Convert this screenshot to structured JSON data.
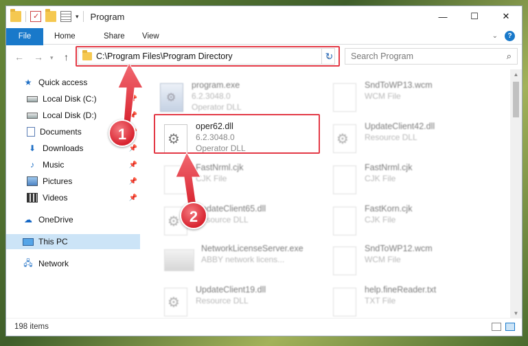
{
  "window": {
    "title": "Program",
    "controls": {
      "minimize": "—",
      "maximize": "☐",
      "close": "✕"
    }
  },
  "ribbon": {
    "tabs": [
      "File",
      "Home",
      "Share",
      "View"
    ]
  },
  "address": {
    "path": "C:\\Program Files\\Program Directory",
    "search_placeholder": "Search Program"
  },
  "sidebar": {
    "items": [
      {
        "label": "Quick access",
        "icon": "star-icon",
        "pinned": false
      },
      {
        "label": "Local Disk (C:)",
        "icon": "disk-icon",
        "pinned": true
      },
      {
        "label": "Local Disk (D:)",
        "icon": "disk-icon",
        "pinned": true
      },
      {
        "label": "Documents",
        "icon": "documents-icon",
        "pinned": true
      },
      {
        "label": "Downloads",
        "icon": "download-icon",
        "pinned": true
      },
      {
        "label": "Music",
        "icon": "music-icon",
        "pinned": true
      },
      {
        "label": "Pictures",
        "icon": "pictures-icon",
        "pinned": true
      },
      {
        "label": "Videos",
        "icon": "videos-icon",
        "pinned": true
      },
      {
        "label": "OneDrive",
        "icon": "cloud-icon",
        "pinned": false
      },
      {
        "label": "This PC",
        "icon": "computer-icon",
        "pinned": false,
        "selected": true
      },
      {
        "label": "Network",
        "icon": "network-icon",
        "pinned": false
      }
    ]
  },
  "files": {
    "left": [
      {
        "name": "program.exe",
        "line2": "6.2.3048.0",
        "line3": "Operator DLL"
      },
      {
        "name": "oper62.dll",
        "line2": "6.2.3048.0",
        "line3": "Operator DLL"
      },
      {
        "name": "FastNrml.cjk",
        "line2": "CJK File",
        "line3": ""
      },
      {
        "name": "UpdateClient65.dll",
        "line2": "Resource DLL",
        "line3": ""
      },
      {
        "name": "NetworkLicenseServer.exe",
        "line2": "ABBY network licens...",
        "line3": ""
      },
      {
        "name": "UpdateClient19.dll",
        "line2": "Resource DLL",
        "line3": ""
      }
    ],
    "right": [
      {
        "name": "SndToWP13.wcm",
        "line2": "WCM File"
      },
      {
        "name": "UpdateClient42.dll",
        "line2": "Resource DLL"
      },
      {
        "name": "FastNrml.cjk",
        "line2": "CJK File"
      },
      {
        "name": "FastKorn.cjk",
        "line2": "CJK File"
      },
      {
        "name": "SndToWP12.wcm",
        "line2": "WCM File"
      },
      {
        "name": "help.fineReader.txt",
        "line2": "TXT File"
      }
    ]
  },
  "status": {
    "count": "198 items"
  },
  "markers": [
    "1",
    "2"
  ],
  "colors": {
    "accent": "#1979ca",
    "highlight": "#e33845",
    "selected": "#cce4f7"
  }
}
